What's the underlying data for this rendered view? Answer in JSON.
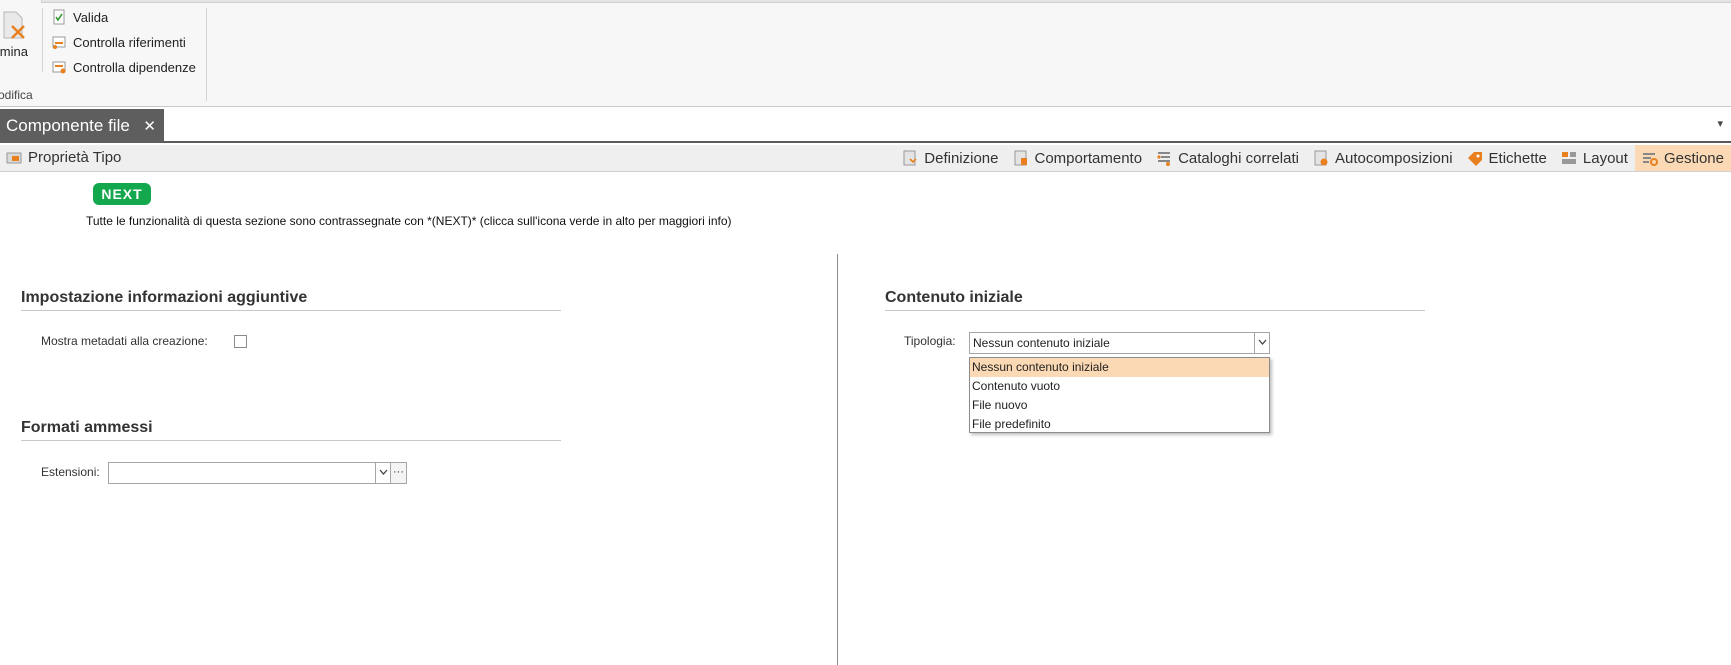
{
  "ribbon": {
    "big_button_label": "limina",
    "group_label": "odifica",
    "actions": [
      {
        "label": "Valida",
        "icon": "validate-icon"
      },
      {
        "label": "Controlla riferimenti",
        "icon": "check-references-icon"
      },
      {
        "label": "Controlla dipendenze",
        "icon": "check-dependencies-icon"
      }
    ]
  },
  "document_tab": {
    "title": "Componente file",
    "close_glyph": "✕",
    "overflow_glyph": "▾"
  },
  "subbar": {
    "left_label": "Proprietà Tipo",
    "tabs": [
      {
        "label": "Definizione",
        "icon": "definition-icon"
      },
      {
        "label": "Comportamento",
        "icon": "behavior-icon"
      },
      {
        "label": "Cataloghi correlati",
        "icon": "related-catalogs-icon"
      },
      {
        "label": "Autocomposizioni",
        "icon": "autocompositions-icon"
      },
      {
        "label": "Etichette",
        "icon": "tag-icon"
      },
      {
        "label": "Layout",
        "icon": "layout-icon"
      },
      {
        "label": "Gestione",
        "icon": "management-icon",
        "active": true
      }
    ]
  },
  "content": {
    "badge": "NEXT",
    "info": "Tutte le funzionalità di questa sezione sono contrassegnate con *(NEXT)* (clicca sull'icona verde in alto per maggiori info)",
    "left": {
      "section1_title": "Impostazione informazioni aggiuntive",
      "show_metadata_label": "Mostra metadati alla creazione:",
      "show_metadata_checked": false,
      "section2_title": "Formati ammessi",
      "extensions_label": "Estensioni:",
      "extensions_value": "",
      "ellipsis": "···"
    },
    "right": {
      "section_title": "Contenuto iniziale",
      "type_label": "Tipologia:",
      "type_value": "Nessun contenuto iniziale",
      "options": [
        "Nessun contenuto iniziale",
        "Contenuto vuoto",
        "File nuovo",
        "File predefinito"
      ],
      "selected_index": 0
    }
  },
  "colors": {
    "accent_highlight": "#fbd9b4",
    "next_green": "#13a84e",
    "tab_dark": "#5e5e5e"
  }
}
